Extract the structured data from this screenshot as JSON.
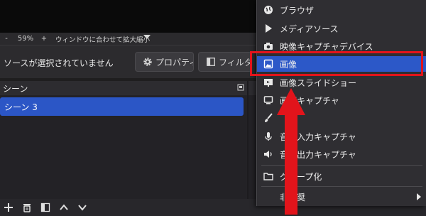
{
  "zoom": {
    "minus": "-",
    "percent": "59%",
    "plus": "+",
    "fit_label": "ウィンドウに合わせて拡大縮小"
  },
  "source_toolbar": {
    "status": "ソースが選択されていません",
    "properties_label": "プロパティ",
    "filters_label": "フィルタ"
  },
  "scenes": {
    "title": "シーン",
    "items": [
      "シーン 3"
    ]
  },
  "context_menu": {
    "items": [
      {
        "label": "ブラウザ",
        "icon": "globe-icon"
      },
      {
        "label": "メディアソース",
        "icon": "play-icon"
      },
      {
        "label": "映像キャプチャデバイス",
        "icon": "camera-icon"
      },
      {
        "label": "画像",
        "icon": "image-icon",
        "selected": true
      },
      {
        "label": "画像スライドショー",
        "icon": "slideshow-icon"
      },
      {
        "label": "画面キャプチャ",
        "icon": "monitor-icon"
      },
      {
        "label": "",
        "icon": "brush-icon"
      },
      {
        "label": "音声入力キャプチャ",
        "icon": "microphone-icon"
      },
      {
        "label": "音声出力キャプチャ",
        "icon": "speaker-icon"
      },
      {
        "label": "グループ化",
        "icon": "folder-icon"
      },
      {
        "label": "非推奨",
        "icon": "",
        "submenu": true
      }
    ]
  },
  "colors": {
    "selection": "#2c58c8",
    "highlight": "#e2141b",
    "background": "#1f1e1f"
  }
}
